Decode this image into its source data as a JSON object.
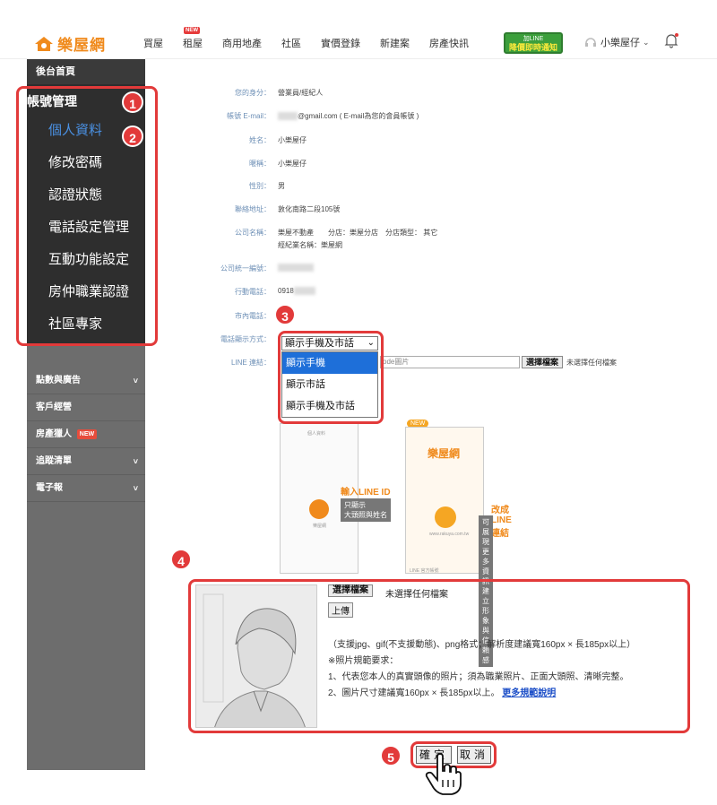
{
  "brand": {
    "name": "樂屋網",
    "color": "#f08a1c"
  },
  "nav": [
    {
      "label": "買屋"
    },
    {
      "label": "租屋",
      "badge": "NEW"
    },
    {
      "label": "商用地產"
    },
    {
      "label": "社區"
    },
    {
      "label": "實價登錄"
    },
    {
      "label": "新建案"
    },
    {
      "label": "房產快訊"
    }
  ],
  "line_banner": {
    "line1": "加LINE",
    "line2": "降價即時通知"
  },
  "user": {
    "name": "小樂屋仔"
  },
  "sidebar": {
    "home": "後台首頁",
    "section_title": "帳號管理",
    "sub_items": [
      "個人資料",
      "修改密碼",
      "認證狀態",
      "電話設定管理",
      "互動功能設定",
      "房仲職業認證",
      "社區專家"
    ],
    "links": [
      {
        "label": "點數與廣告",
        "caret": "˅"
      },
      {
        "label": "客戶經營"
      },
      {
        "label": "房產獵人",
        "badge": "NEW"
      },
      {
        "label": "追蹤清單",
        "caret": "˅"
      },
      {
        "label": "電子報",
        "caret": "˅"
      }
    ]
  },
  "form": {
    "identity": {
      "label": "您的身分：",
      "value": "營業員/經紀人"
    },
    "email": {
      "label": "帳號 E-mail：",
      "value": "@gmail.com ( E-mail為您的會員帳號 )"
    },
    "name": {
      "label": "姓名：",
      "value": "小樂屋仔"
    },
    "nickname": {
      "label": "暱稱：",
      "value": "小樂屋仔"
    },
    "gender": {
      "label": "性別：",
      "value": "男"
    },
    "address": {
      "label": "聯絡地址：",
      "value": "敦化南路二段105號"
    },
    "company": {
      "label": "公司名稱：",
      "value": "樂屋不動產　　分店：樂屋分店　分店類型： 其它",
      "value2": "經紀業名稱：樂屋網"
    },
    "tax_id": {
      "label": "公司統一編號："
    },
    "mobile": {
      "label": "行動電話：",
      "value": "0918"
    },
    "landline": {
      "label": "市內電話："
    },
    "phone_display": {
      "label": "電話顯示方式：",
      "selected": "顯示手機及市話",
      "options": [
        "顯示手機",
        "顯示市話",
        "顯示手機及市話"
      ]
    },
    "line": {
      "label": "LINE 連結：",
      "placeholder": "ode圖片",
      "file_button": "選擇檔案",
      "no_file": "未選擇任何檔案"
    }
  },
  "illustration": {
    "new_tag": "NEW",
    "left_title": "輸入LINE ID",
    "left_note1": "只顯示",
    "left_note2": "大頭照與姓名",
    "right_title": "改成LINE連結",
    "right_note1": "可展現更多資訊",
    "right_note2": "建立形象與信賴感",
    "phone_title": "個人資料",
    "phone_brand": "樂屋網",
    "phone_site": "www.rakuya.com.tw",
    "phone_user": "樂屋網",
    "phone_footer": "LINE 官方帳號"
  },
  "photo": {
    "file_button": "選擇檔案",
    "no_file": "未選擇任何檔案",
    "upload": "上傳",
    "format_note": "（支援jpg、gif(不支援動態)、png格式；解析度建議寬160px × 長185px以上）",
    "rule_title": "※照片規範要求：",
    "rule1": "1、代表您本人的真實頭像的照片；須為職業照片、正面大頭照、清晰完整。",
    "rule2": "2、圖片尺寸建議寬160px × 長185px以上。",
    "more_link": "更多規範說明"
  },
  "actions": {
    "ok": "確定",
    "cancel": "取消"
  },
  "callouts": [
    "1",
    "2",
    "3",
    "4",
    "5"
  ],
  "colors": {
    "highlight": "#e23a3a",
    "link_label": "#6d8fb6",
    "active": "#4a90e2"
  }
}
